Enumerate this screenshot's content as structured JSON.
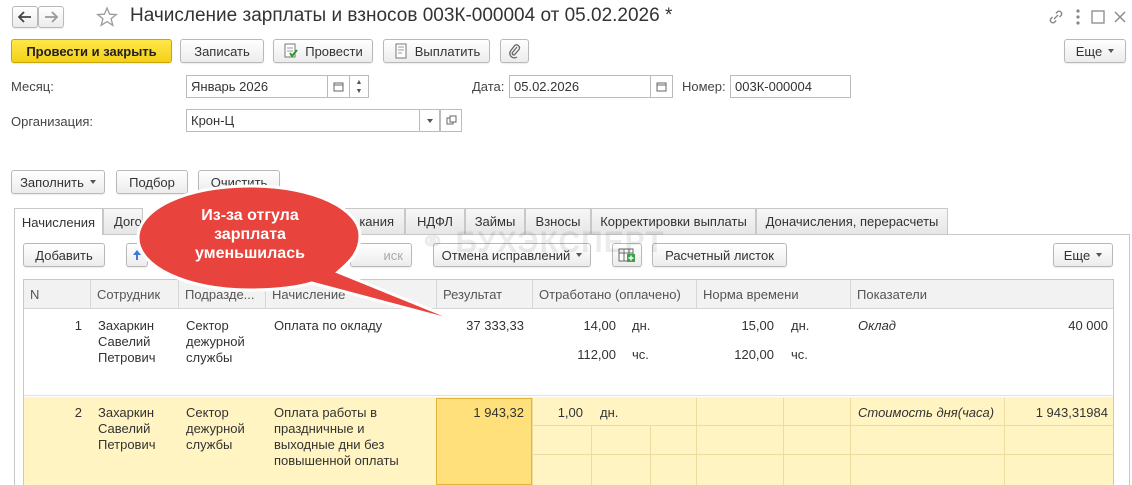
{
  "title": "Начисление зарплаты и взносов 003К-000004 от 05.02.2026 *",
  "toolbar": {
    "post_close": "Провести и закрыть",
    "save": "Записать",
    "post": "Провести",
    "pay": "Выплатить",
    "more": "Еще"
  },
  "form": {
    "month_label": "Месяц:",
    "month_value": "Январь 2026",
    "date_label": "Дата:",
    "date_value": "05.02.2026",
    "number_label": "Номер:",
    "number_value": "003К-000004",
    "org_label": "Организация:",
    "org_value": "Крон-Ц"
  },
  "actions": {
    "fill": "Заполнить",
    "select": "Подбор",
    "clear": "Очистить"
  },
  "tabs": [
    {
      "label": "Начисления"
    },
    {
      "label": "Дого"
    },
    {
      "label": "кания"
    },
    {
      "label": "НДФЛ"
    },
    {
      "label": "Займы"
    },
    {
      "label": "Взносы"
    },
    {
      "label": "Корректировки выплаты"
    },
    {
      "label": "Доначисления, перерасчеты"
    }
  ],
  "grid_toolbar": {
    "add": "Добавить",
    "search_tail": "иск",
    "cancel_fixes": "Отмена исправлений",
    "payslip": "Расчетный листок",
    "more": "Еще"
  },
  "columns": {
    "n": "N",
    "employee": "Сотрудник",
    "dept": "Подразде...",
    "accrual": "Начисление",
    "result": "Результат",
    "worked": "Отработано (оплачено)",
    "norm": "Норма времени",
    "indicators": "Показатели"
  },
  "rows": [
    {
      "n": "1",
      "employee": [
        "Захаркин",
        "Савелий",
        "Петрович"
      ],
      "dept": [
        "Сектор",
        "дежурной",
        "службы"
      ],
      "accrual": "Оплата по окладу",
      "result": "37 333,33",
      "worked_days": "14,00",
      "days_unit": "дн.",
      "worked_hours": "112,00",
      "hours_unit": "чс.",
      "norm_days": "15,00",
      "norm_hours": "120,00",
      "indicator_name": "Оклад",
      "indicator_value": "40 000"
    },
    {
      "n": "2",
      "employee": [
        "Захаркин",
        "Савелий",
        "Петрович"
      ],
      "dept": [
        "Сектор",
        "дежурной",
        "службы"
      ],
      "accrual": [
        "Оплата работы в",
        "праздничные и",
        "выходные дни без",
        "повышенной оплаты"
      ],
      "result": "1 943,32",
      "worked_days": "1,00",
      "days_unit": "дн.",
      "indicator_name": "Стоимость дня(часа)",
      "indicator_value": "1 943,31984"
    }
  ],
  "callout": {
    "text": [
      "Из-за отгула",
      "зарплата",
      "уменьшилась"
    ]
  },
  "watermark": "БУХЭКСПЕРТ",
  "colors": {
    "primary_button": "#f4cf18",
    "selected_row": "#fff4c2",
    "selected_cell": "#ffe07a",
    "callout_fill": "#e8433c",
    "callout_text": "#ffffff"
  }
}
